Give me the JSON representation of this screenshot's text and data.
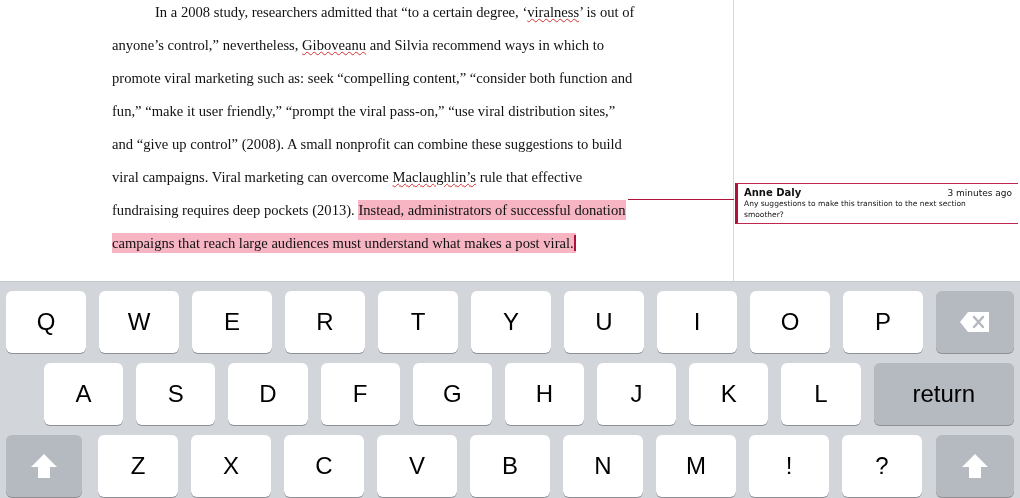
{
  "document": {
    "lines": [
      {
        "segments": [
          {
            "text": "In a 2008 study, researchers admitted that “to a certain degree, ‘",
            "misspelled": false,
            "highlighted": false
          },
          {
            "text": "viralness",
            "misspelled": true,
            "highlighted": false
          },
          {
            "text": "’ is out of",
            "misspelled": false,
            "highlighted": false
          }
        ]
      },
      {
        "segments": [
          {
            "text": "anyone’s control,” nevertheless, ",
            "misspelled": false,
            "highlighted": false
          },
          {
            "text": "Giboveanu",
            "misspelled": true,
            "highlighted": false
          },
          {
            "text": " and Silvia recommend ways in which to",
            "misspelled": false,
            "highlighted": false
          }
        ]
      },
      {
        "segments": [
          {
            "text": "promote viral marketing such as: seek “compelling content,” “consider both function and",
            "misspelled": false,
            "highlighted": false
          }
        ]
      },
      {
        "segments": [
          {
            "text": "fun,” “make it user friendly,” “prompt the viral pass-on,” “use viral distribution sites,”",
            "misspelled": false,
            "highlighted": false
          }
        ]
      },
      {
        "segments": [
          {
            "text": "and “give up control” (2008). A small nonprofit can combine these suggestions to build",
            "misspelled": false,
            "highlighted": false
          }
        ]
      },
      {
        "segments": [
          {
            "text": "viral campaigns. Viral marketing can overcome ",
            "misspelled": false,
            "highlighted": false
          },
          {
            "text": "Maclaughlin’s",
            "misspelled": true,
            "highlighted": false
          },
          {
            "text": " rule that effective",
            "misspelled": false,
            "highlighted": false
          }
        ]
      },
      {
        "segments": [
          {
            "text": "fundraising requires deep pockets (2013). ",
            "misspelled": false,
            "highlighted": false
          },
          {
            "text": "Instead, administrators of successful donation ",
            "misspelled": false,
            "highlighted": true
          }
        ]
      },
      {
        "segments": [
          {
            "text": "campaigns that reach large audiences must understand what makes a post viral.",
            "misspelled": false,
            "highlighted": true
          }
        ]
      }
    ]
  },
  "comment": {
    "author": "Anne Daly",
    "time": "3 minutes ago",
    "text": "Any suggestions to make this transition to the next section smoother?"
  },
  "keyboard": {
    "rows": [
      [
        {
          "kind": "letter",
          "label": "Q"
        },
        {
          "kind": "letter",
          "label": "W"
        },
        {
          "kind": "letter",
          "label": "E"
        },
        {
          "kind": "letter",
          "label": "R"
        },
        {
          "kind": "letter",
          "label": "T"
        },
        {
          "kind": "letter",
          "label": "Y"
        },
        {
          "kind": "letter",
          "label": "U"
        },
        {
          "kind": "letter",
          "label": "I"
        },
        {
          "kind": "letter",
          "label": "O"
        },
        {
          "kind": "letter",
          "label": "P"
        },
        {
          "kind": "backspace"
        }
      ],
      [
        {
          "kind": "letter",
          "label": "A"
        },
        {
          "kind": "letter",
          "label": "S"
        },
        {
          "kind": "letter",
          "label": "D"
        },
        {
          "kind": "letter",
          "label": "F"
        },
        {
          "kind": "letter",
          "label": "G"
        },
        {
          "kind": "letter",
          "label": "H"
        },
        {
          "kind": "letter",
          "label": "J"
        },
        {
          "kind": "letter",
          "label": "K"
        },
        {
          "kind": "letter",
          "label": "L"
        },
        {
          "kind": "return",
          "label": "return"
        }
      ],
      [
        {
          "kind": "shift"
        },
        {
          "kind": "letter",
          "label": "Z"
        },
        {
          "kind": "letter",
          "label": "X"
        },
        {
          "kind": "letter",
          "label": "C"
        },
        {
          "kind": "letter",
          "label": "V"
        },
        {
          "kind": "letter",
          "label": "B"
        },
        {
          "kind": "letter",
          "label": "N"
        },
        {
          "kind": "letter",
          "label": "M"
        },
        {
          "kind": "letter",
          "label": "!"
        },
        {
          "kind": "letter",
          "label": "?"
        },
        {
          "kind": "shift"
        }
      ]
    ]
  }
}
